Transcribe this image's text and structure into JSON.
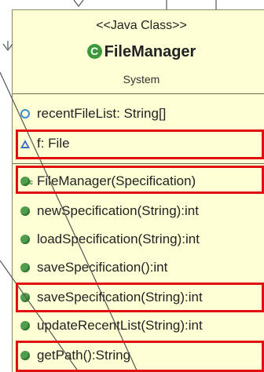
{
  "class": {
    "stereotype": "<<Java Class>>",
    "icon_letter": "C",
    "name": "FileManager",
    "package": "System"
  },
  "attributes": [
    {
      "visibility": "private",
      "icon": "private-field-icon",
      "text": "recentFileList: String[]",
      "highlighted": false
    },
    {
      "visibility": "package",
      "icon": "package-field-icon",
      "text": "f: File",
      "highlighted": true
    }
  ],
  "methods": [
    {
      "icon": "constructor-icon",
      "text": "FileManager(Specification)",
      "highlighted": true
    },
    {
      "icon": "public-method-icon",
      "text": "newSpecification(String):int",
      "highlighted": false
    },
    {
      "icon": "public-method-icon",
      "text": "loadSpecification(String):int",
      "highlighted": false
    },
    {
      "icon": "public-method-icon",
      "text": "saveSpecification():int",
      "highlighted": false
    },
    {
      "icon": "public-method-icon",
      "text": "saveSpecification(String):int",
      "highlighted": true
    },
    {
      "icon": "public-method-icon",
      "text": "updateRecentList(String):int",
      "highlighted": false
    },
    {
      "icon": "public-method-icon",
      "text": "getPath():String",
      "highlighted": true
    }
  ],
  "colors": {
    "class_fill": "#ffffd6",
    "highlight": "#e01010",
    "method_icon": "#4e9e4e",
    "connector": "#555555"
  }
}
